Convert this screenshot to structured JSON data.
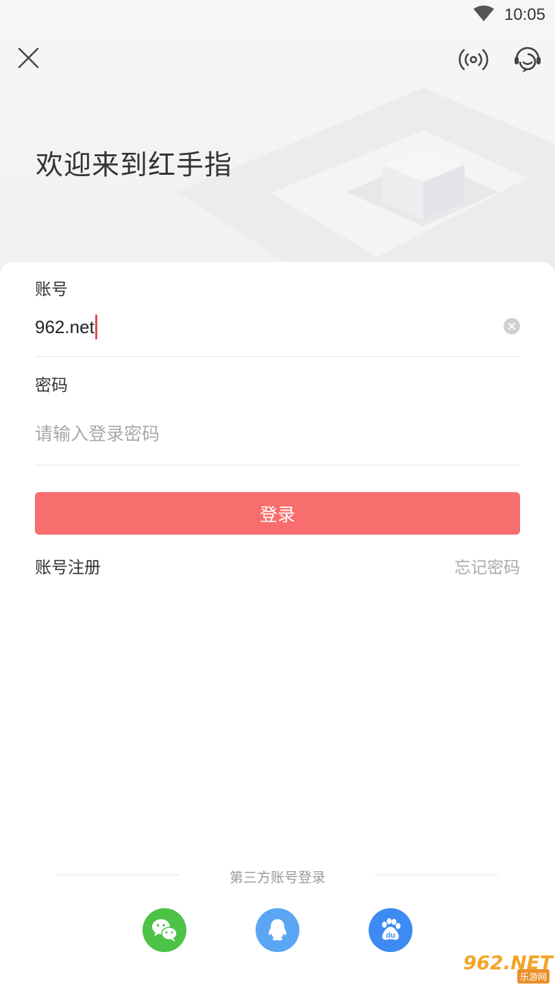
{
  "status_bar": {
    "time": "10:05",
    "wifi_icon": "wifi-icon"
  },
  "header": {
    "close_icon": "close-icon",
    "signal_icon": "broadcast-signal-icon",
    "support_icon": "customer-service-icon",
    "title": "欢迎来到红手指"
  },
  "form": {
    "account_label": "账号",
    "account_value": "962.net",
    "clear_icon": "clear-icon",
    "password_label": "密码",
    "password_placeholder": "请输入登录密码",
    "login_label": "登录",
    "register_label": "账号注册",
    "forgot_label": "忘记密码"
  },
  "third_party": {
    "title": "第三方账号登录",
    "providers": [
      {
        "name": "wechat",
        "icon": "wechat-icon",
        "color": "#4dc247"
      },
      {
        "name": "qq",
        "icon": "qq-icon",
        "color": "#5ba6f4"
      },
      {
        "name": "baidu",
        "icon": "baidu-icon",
        "color": "#3d8af2"
      }
    ]
  },
  "watermark": {
    "main": "962.NET",
    "sub": "乐游网"
  },
  "colors": {
    "accent": "#f86d6e",
    "cursor": "#e0474c"
  }
}
